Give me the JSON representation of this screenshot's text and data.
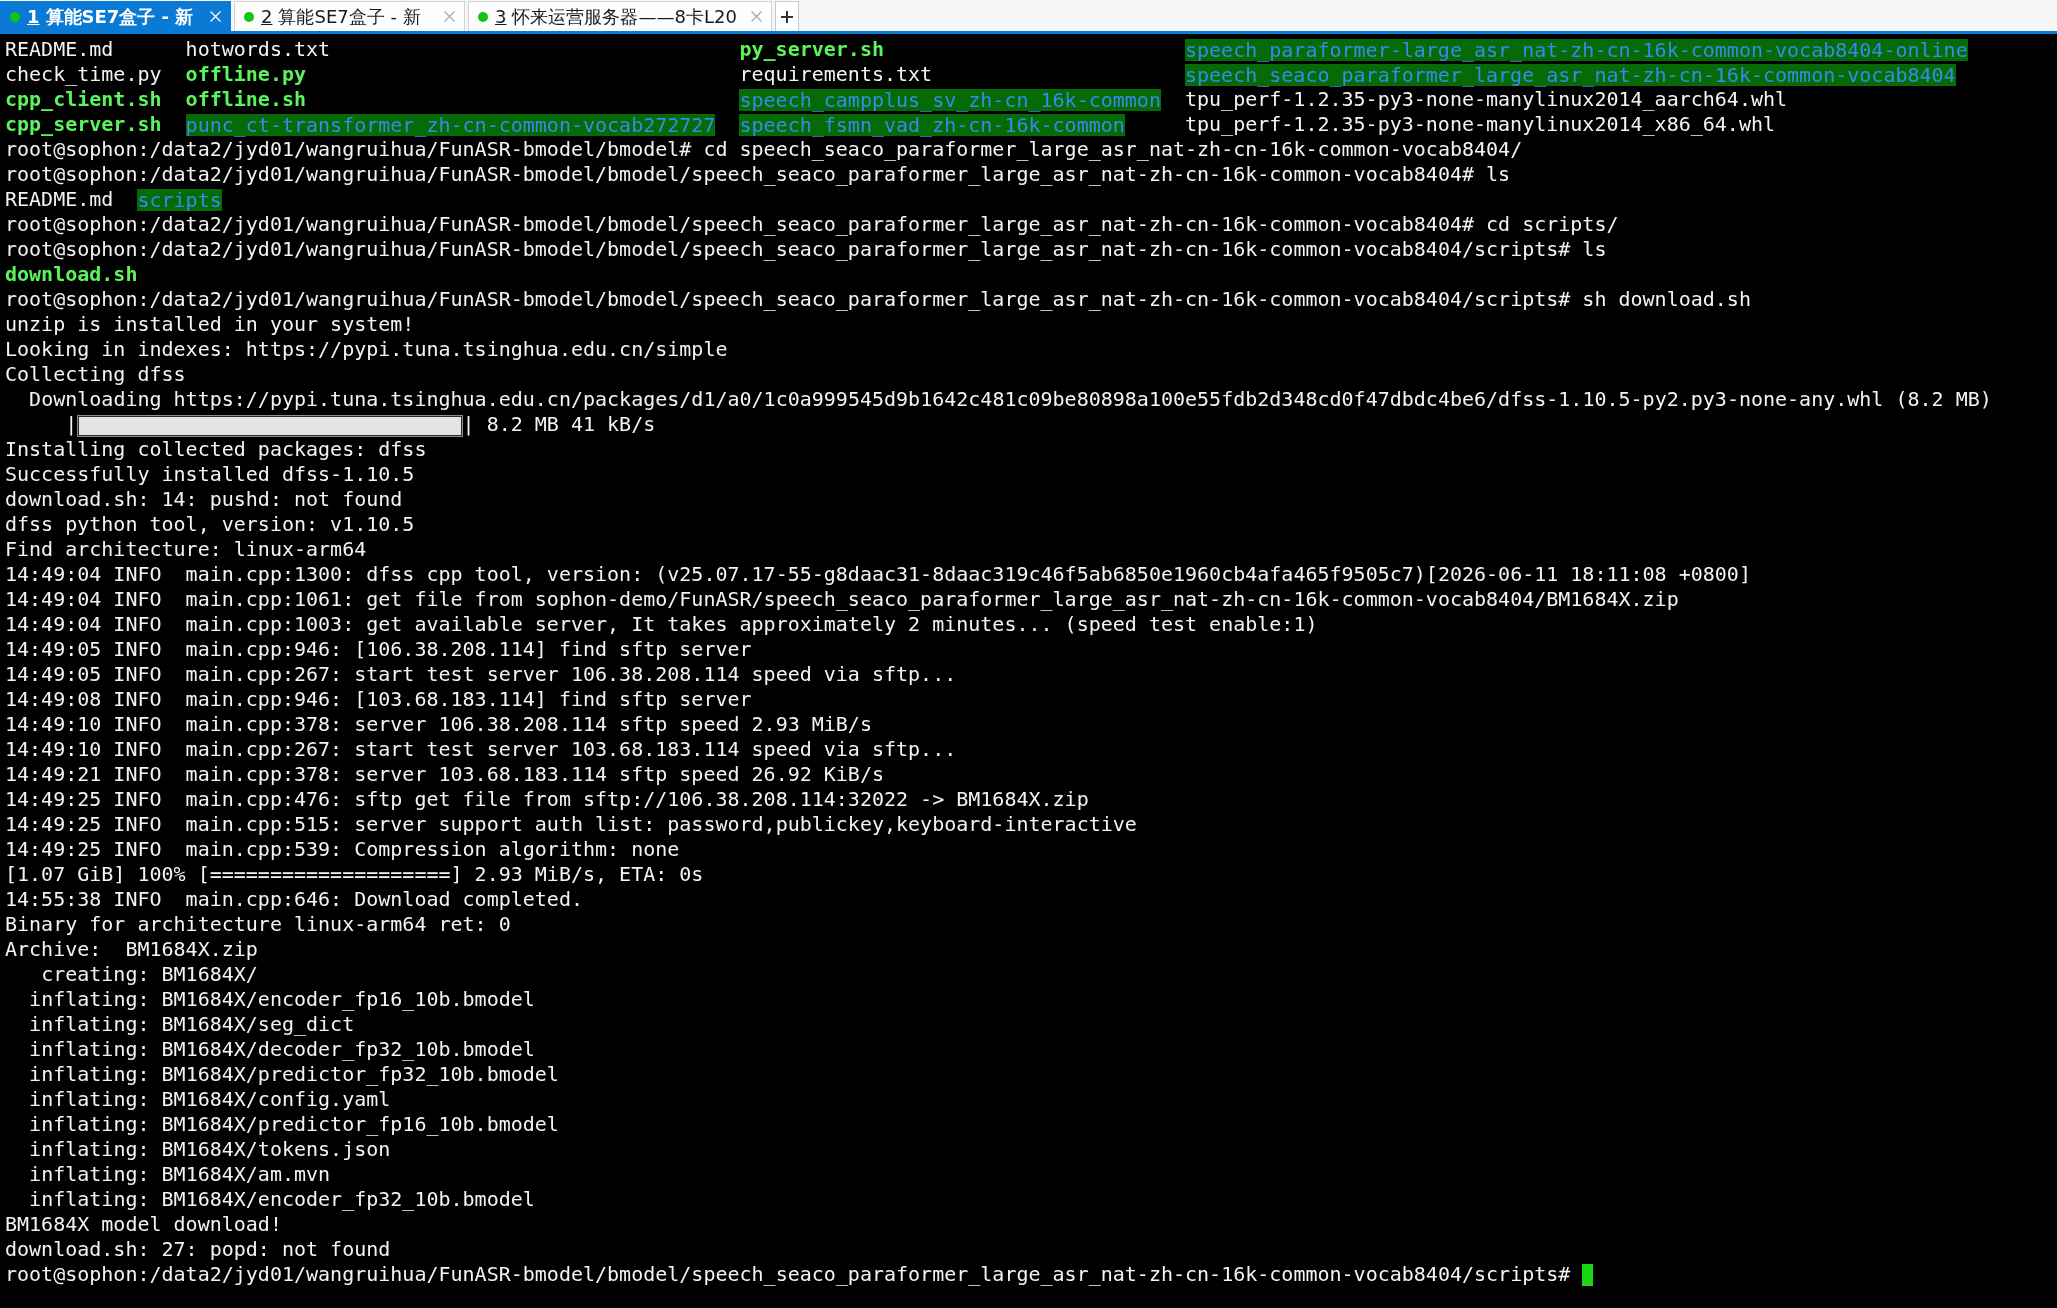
{
  "tabs": [
    {
      "number": "1",
      "title": "算能SE7盒子 - 新",
      "selected": true,
      "connected": true
    },
    {
      "number": "2",
      "title": "算能SE7盒子 - 新",
      "selected": false,
      "connected": true
    },
    {
      "number": "3",
      "title": "怀来运营服务器——8卡L20",
      "selected": false,
      "connected": true
    }
  ],
  "terminal": {
    "lines": [
      {
        "kind": "listing",
        "columns": [
          [
            {
              "name": "README.md",
              "kind": "file"
            },
            {
              "name": "check_time.py",
              "kind": "file"
            },
            {
              "name": "cpp_client.sh",
              "kind": "executable"
            },
            {
              "name": "cpp_server.sh",
              "kind": "executable"
            }
          ],
          [
            {
              "name": "hotwords.txt",
              "kind": "file"
            },
            {
              "name": "offline.py",
              "kind": "executable"
            },
            {
              "name": "offline.sh",
              "kind": "executable"
            },
            {
              "name": "punc_ct-transformer_zh-cn-common-vocab272727",
              "kind": "directory"
            }
          ],
          [
            {
              "name": "py_server.sh",
              "kind": "executable"
            },
            {
              "name": "requirements.txt",
              "kind": "file"
            },
            {
              "name": "speech_campplus_sv_zh-cn_16k-common",
              "kind": "directory"
            },
            {
              "name": "speech_fsmn_vad_zh-cn-16k-common",
              "kind": "directory"
            }
          ],
          [
            {
              "name": "speech_paraformer-large_asr_nat-zh-cn-16k-common-vocab8404-online",
              "kind": "directory"
            },
            {
              "name": "speech_seaco_paraformer_large_asr_nat-zh-cn-16k-common-vocab8404",
              "kind": "directory"
            },
            {
              "name": "tpu_perf-1.2.35-py3-none-manylinux2014_aarch64.whl",
              "kind": "file"
            },
            {
              "name": "tpu_perf-1.2.35-py3-none-manylinux2014_x86_64.whl",
              "kind": "file"
            }
          ]
        ]
      },
      {
        "kind": "text",
        "text": "root@sophon:/data2/jyd01/wangruihua/FunASR-bmodel/bmodel# cd speech_seaco_paraformer_large_asr_nat-zh-cn-16k-common-vocab8404/"
      },
      {
        "kind": "text",
        "text": "root@sophon:/data2/jyd01/wangruihua/FunASR-bmodel/bmodel/speech_seaco_paraformer_large_asr_nat-zh-cn-16k-common-vocab8404# ls"
      },
      {
        "kind": "listing",
        "columns": [
          [
            {
              "name": "README.md",
              "kind": "file"
            }
          ],
          [
            {
              "name": "scripts",
              "kind": "directory"
            }
          ]
        ]
      },
      {
        "kind": "text",
        "text": "root@sophon:/data2/jyd01/wangruihua/FunASR-bmodel/bmodel/speech_seaco_paraformer_large_asr_nat-zh-cn-16k-common-vocab8404# cd scripts/"
      },
      {
        "kind": "text",
        "text": "root@sophon:/data2/jyd01/wangruihua/FunASR-bmodel/bmodel/speech_seaco_paraformer_large_asr_nat-zh-cn-16k-common-vocab8404/scripts# ls"
      },
      {
        "kind": "listing",
        "columns": [
          [
            {
              "name": "download.sh",
              "kind": "executable"
            }
          ]
        ]
      },
      {
        "kind": "text",
        "text": "root@sophon:/data2/jyd01/wangruihua/FunASR-bmodel/bmodel/speech_seaco_paraformer_large_asr_nat-zh-cn-16k-common-vocab8404/scripts# sh download.sh"
      },
      {
        "kind": "text",
        "text": "unzip is installed in your system!"
      },
      {
        "kind": "text",
        "text": "Looking in indexes: https://pypi.tuna.tsinghua.edu.cn/simple"
      },
      {
        "kind": "text",
        "text": "Collecting dfss"
      },
      {
        "kind": "text",
        "text": "  Downloading https://pypi.tuna.tsinghua.edu.cn/packages/d1/a0/1c0a999545d9b1642c481c09be80898a100e55fdb2d348cd0f47dbdc4be6/dfss-1.10.5-py2.py3-none-any.whl (8.2 MB)"
      },
      {
        "kind": "progress",
        "before": "     |",
        "level": 1,
        "after": "| 8.2 MB 41 kB/s"
      },
      {
        "kind": "text",
        "text": "Installing collected packages: dfss"
      },
      {
        "kind": "text",
        "text": "Successfully installed dfss-1.10.5"
      },
      {
        "kind": "text",
        "text": "download.sh: 14: pushd: not found"
      },
      {
        "kind": "text",
        "text": "dfss python tool, version: v1.10.5"
      },
      {
        "kind": "text",
        "text": "Find architecture: linux-arm64"
      },
      {
        "kind": "text",
        "text": "14:49:04 INFO  main.cpp:1300: dfss cpp tool, version: (v25.07.17-55-g8daac31-8daac319c46f5ab6850e1960cb4afa465f9505c7)[2026-06-11 18:11:08 +0800]"
      },
      {
        "kind": "text",
        "text": "14:49:04 INFO  main.cpp:1061: get file from sophon-demo/FunASR/speech_seaco_paraformer_large_asr_nat-zh-cn-16k-common-vocab8404/BM1684X.zip"
      },
      {
        "kind": "text",
        "text": "14:49:04 INFO  main.cpp:1003: get available server, It takes approximately 2 minutes... (speed test enable:1)"
      },
      {
        "kind": "text",
        "text": "14:49:05 INFO  main.cpp:946: [106.38.208.114] find sftp server"
      },
      {
        "kind": "text",
        "text": "14:49:05 INFO  main.cpp:267: start test server 106.38.208.114 speed via sftp..."
      },
      {
        "kind": "text",
        "text": "14:49:08 INFO  main.cpp:946: [103.68.183.114] find sftp server"
      },
      {
        "kind": "text",
        "text": "14:49:10 INFO  main.cpp:378: server 106.38.208.114 sftp speed 2.93 MiB/s"
      },
      {
        "kind": "text",
        "text": "14:49:10 INFO  main.cpp:267: start test server 103.68.183.114 speed via sftp..."
      },
      {
        "kind": "text",
        "text": "14:49:21 INFO  main.cpp:378: server 103.68.183.114 sftp speed 26.92 KiB/s"
      },
      {
        "kind": "text",
        "text": "14:49:25 INFO  main.cpp:476: sftp get file from sftp://106.38.208.114:32022 -> BM1684X.zip"
      },
      {
        "kind": "text",
        "text": "14:49:25 INFO  main.cpp:515: server support auth list: password,publickey,keyboard-interactive"
      },
      {
        "kind": "text",
        "text": "14:49:25 INFO  main.cpp:539: Compression algorithm: none"
      },
      {
        "kind": "text",
        "text": "[1.07 GiB] 100% [====================] 2.93 MiB/s, ETA: 0s"
      },
      {
        "kind": "text",
        "text": "14:55:38 INFO  main.cpp:646: Download completed."
      },
      {
        "kind": "text",
        "text": "Binary for architecture linux-arm64 ret: 0"
      },
      {
        "kind": "text",
        "text": "Archive:  BM1684X.zip"
      },
      {
        "kind": "text",
        "text": "   creating: BM1684X/"
      },
      {
        "kind": "text",
        "text": "  inflating: BM1684X/encoder_fp16_10b.bmodel"
      },
      {
        "kind": "text",
        "text": "  inflating: BM1684X/seg_dict"
      },
      {
        "kind": "text",
        "text": "  inflating: BM1684X/decoder_fp32_10b.bmodel"
      },
      {
        "kind": "text",
        "text": "  inflating: BM1684X/predictor_fp32_10b.bmodel"
      },
      {
        "kind": "text",
        "text": "  inflating: BM1684X/config.yaml"
      },
      {
        "kind": "text",
        "text": "  inflating: BM1684X/predictor_fp16_10b.bmodel"
      },
      {
        "kind": "text",
        "text": "  inflating: BM1684X/tokens.json"
      },
      {
        "kind": "text",
        "text": "  inflating: BM1684X/am.mvn"
      },
      {
        "kind": "text",
        "text": "  inflating: BM1684X/encoder_fp32_10b.bmodel"
      },
      {
        "kind": "text",
        "text": "BM1684X model download!"
      },
      {
        "kind": "text",
        "text": "download.sh: 27: popd: not found"
      },
      {
        "kind": "prompt",
        "text": "root@sophon:/data2/jyd01/wangruihua/FunASR-bmodel/bmodel/speech_seaco_paraformer_large_asr_nat-zh-cn-16k-common-vocab8404/scripts#",
        "cursor": true
      }
    ]
  }
}
